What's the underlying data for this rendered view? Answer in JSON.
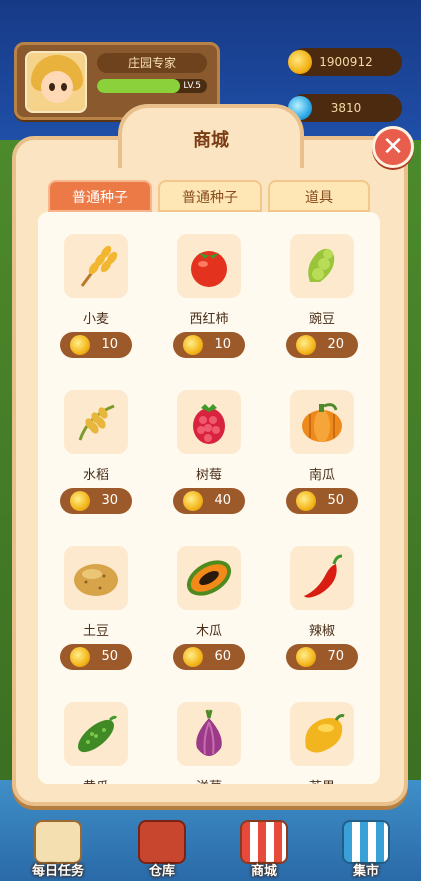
{
  "player": {
    "name": "庄园专家",
    "level_label": "LV.5",
    "level_progress": 0.75
  },
  "currency": {
    "coins": "1900912",
    "gems": "3810"
  },
  "shop": {
    "title": "商城",
    "close_label": "✕",
    "tabs": [
      {
        "label": "普通种子",
        "active": true
      },
      {
        "label": "普通种子",
        "active": false
      },
      {
        "label": "道具",
        "active": false
      }
    ],
    "items": [
      {
        "name": "小麦",
        "price": "10",
        "icon": "wheat-icon"
      },
      {
        "name": "西红柿",
        "price": "10",
        "icon": "tomato-icon"
      },
      {
        "name": "豌豆",
        "price": "20",
        "icon": "pea-icon"
      },
      {
        "name": "水稻",
        "price": "30",
        "icon": "rice-icon"
      },
      {
        "name": "树莓",
        "price": "40",
        "icon": "raspberry-icon"
      },
      {
        "name": "南瓜",
        "price": "50",
        "icon": "pumpkin-icon"
      },
      {
        "name": "土豆",
        "price": "50",
        "icon": "potato-icon"
      },
      {
        "name": "木瓜",
        "price": "60",
        "icon": "papaya-icon"
      },
      {
        "name": "辣椒",
        "price": "70",
        "icon": "chili-icon"
      },
      {
        "name": "黄瓜",
        "price": "",
        "icon": "cucumber-icon"
      },
      {
        "name": "洋葱",
        "price": "",
        "icon": "onion-icon"
      },
      {
        "name": "芒果",
        "price": "",
        "icon": "mango-icon"
      }
    ]
  },
  "nav": {
    "items": [
      {
        "label": "每日任务",
        "icon": "daily-task-icon"
      },
      {
        "label": "仓库",
        "icon": "barn-icon"
      },
      {
        "label": "商城",
        "icon": "shop-icon"
      },
      {
        "label": "集市",
        "icon": "market-icon"
      }
    ]
  },
  "colors": {
    "accent": "#ec7a47",
    "panel": "#fbe4c2",
    "price_bg": "#9c5a2a"
  }
}
